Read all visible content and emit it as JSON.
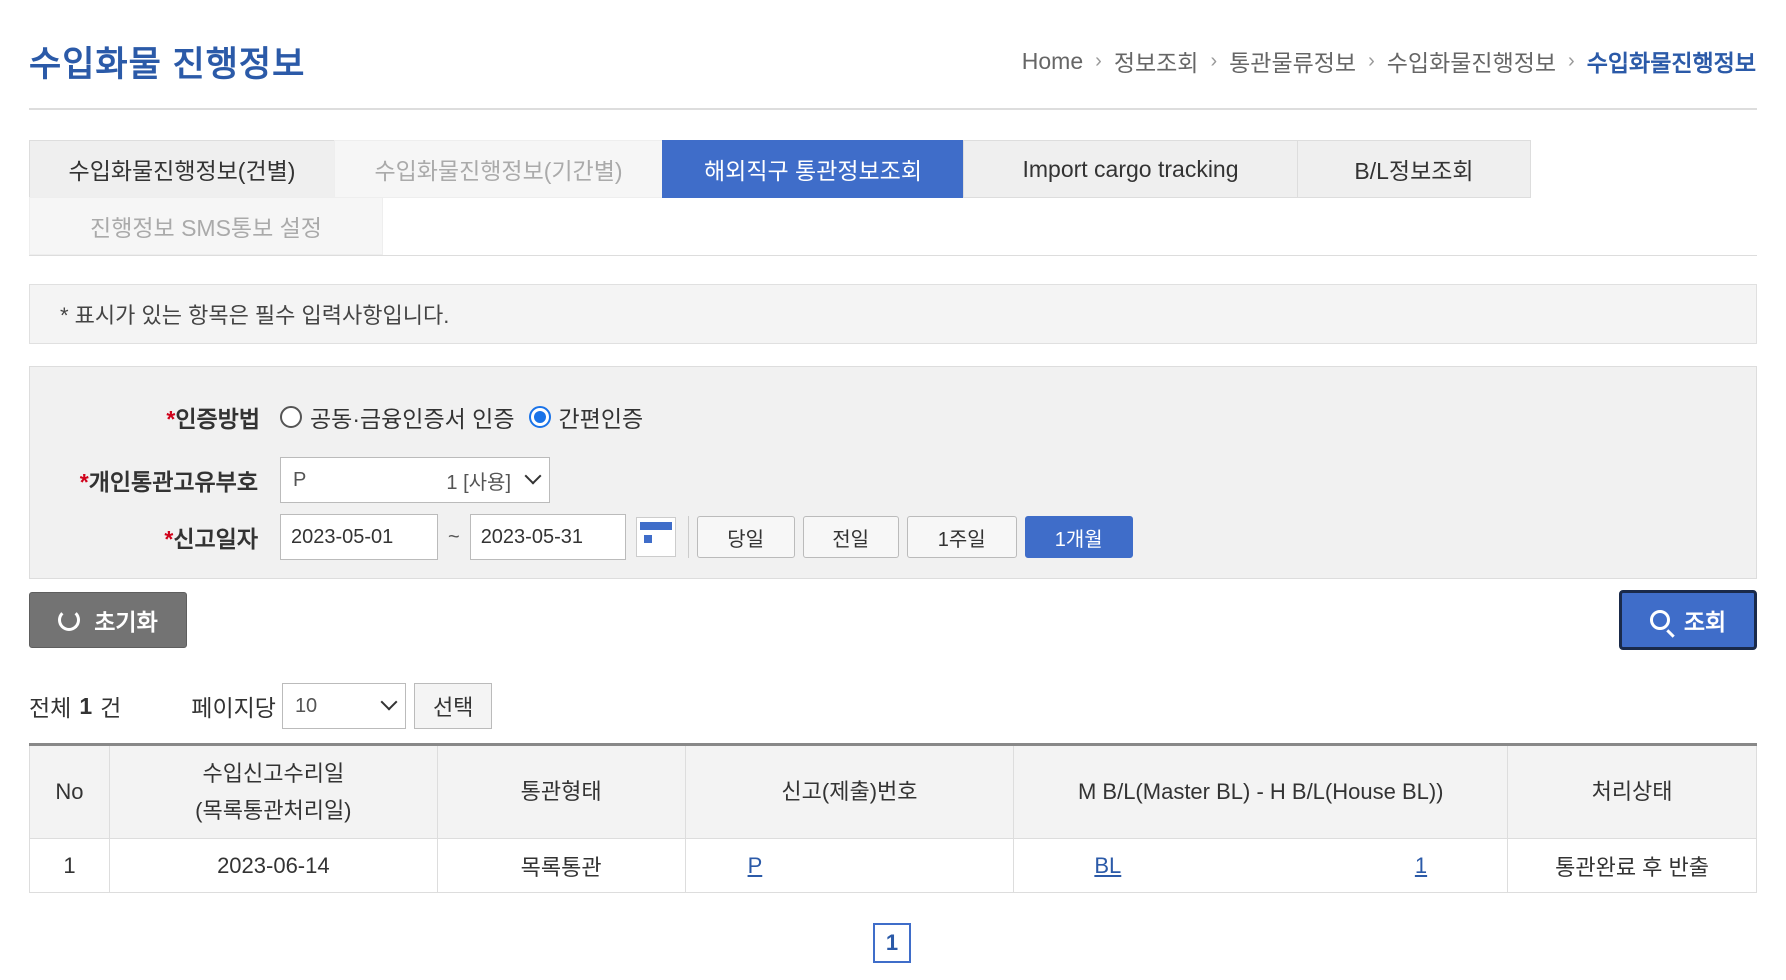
{
  "header": {
    "title": "수입화물 진행정보",
    "breadcrumb": [
      "Home",
      "정보조회",
      "통관물류정보",
      "수입화물진행정보",
      "수입화물진행정보"
    ]
  },
  "tabs": [
    {
      "label": "수입화물진행정보(건별)",
      "state": "normal"
    },
    {
      "label": "수입화물진행정보(기간별)",
      "state": "disabled"
    },
    {
      "label": "해외직구 통관정보조회",
      "state": "active"
    },
    {
      "label": "Import cargo tracking",
      "state": "normal"
    },
    {
      "label": "B/L정보조회",
      "state": "normal"
    },
    {
      "label": "진행정보 SMS통보 설정",
      "state": "disabled"
    }
  ],
  "notice": "* 표시가 있는 항목은 필수 입력사항입니다.",
  "form": {
    "auth_label": "인증방법",
    "auth_options": [
      {
        "label": "공동·금융인증서 인증",
        "checked": false
      },
      {
        "label": "간편인증",
        "checked": true
      }
    ],
    "customs_id_label": "개인통관고유부호",
    "customs_id_prefix": "P",
    "customs_id_value": "1 [사용]",
    "date_label": "신고일자",
    "date_from": "2023-05-01",
    "date_sep": "~",
    "date_to": "2023-05-31",
    "periods": [
      {
        "label": "당일",
        "active": false
      },
      {
        "label": "전일",
        "active": false
      },
      {
        "label": "1주일",
        "active": false
      },
      {
        "label": "1개월",
        "active": true
      }
    ],
    "required_mark": "*"
  },
  "buttons": {
    "reset": "초기화",
    "search": "조회",
    "select": "선택"
  },
  "list": {
    "total_prefix": "전체",
    "total_count": "1",
    "total_suffix": "건",
    "per_page_label": "페이지당",
    "per_page_value": "10"
  },
  "table": {
    "headers": [
      "No",
      "수입신고수리일\n(목록통관처리일)",
      "통관형태",
      "신고(제출)번호",
      "M B/L(Master BL) - H B/L(House BL))",
      "처리상태"
    ],
    "rows": [
      {
        "no": "1",
        "date": "2023-06-14",
        "type": "목록통관",
        "decl_no": "P",
        "mbl": "BL",
        "hbl": "1",
        "status": "통관완료 후 반출"
      }
    ]
  },
  "pagination": {
    "current": "1"
  },
  "colors": {
    "accent": "#3f6dc9",
    "title": "#2b5aa8",
    "required": "#d0021b"
  }
}
